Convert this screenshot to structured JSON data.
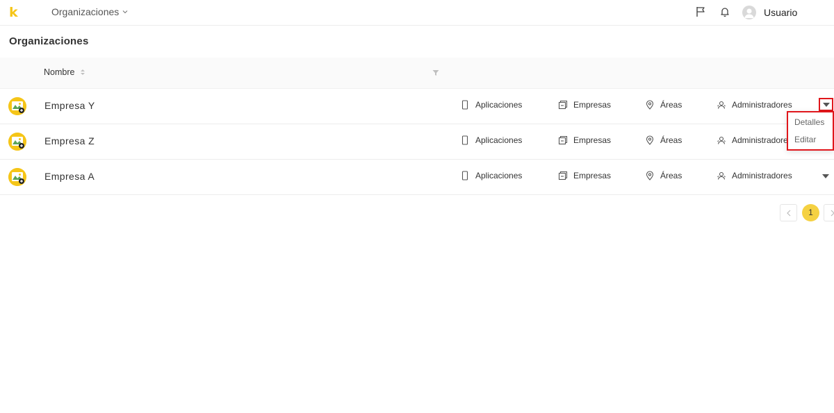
{
  "app": {
    "logo_text": "k",
    "accent_color": "#f5c518"
  },
  "header": {
    "nav_menu_label": "Organizaciones",
    "user_name": "Usuario"
  },
  "page": {
    "title": "Organizaciones"
  },
  "table": {
    "column_name": "Nombre",
    "rows": [
      {
        "name": "Empresa Y",
        "apps": "Aplicaciones",
        "companies": "Empresas",
        "areas": "Áreas",
        "admins": "Administradores"
      },
      {
        "name": "Empresa Z",
        "apps": "Aplicaciones",
        "companies": "Empresas",
        "areas": "Áreas",
        "admins": "Administradores"
      },
      {
        "name": "Empresa A",
        "apps": "Aplicaciones",
        "companies": "Empresas",
        "areas": "Áreas",
        "admins": "Administradores"
      }
    ]
  },
  "dropdown": {
    "items": [
      "Detalles",
      "Editar"
    ],
    "highlight_color": "#e0161b"
  },
  "pagination": {
    "current_page": "1"
  }
}
